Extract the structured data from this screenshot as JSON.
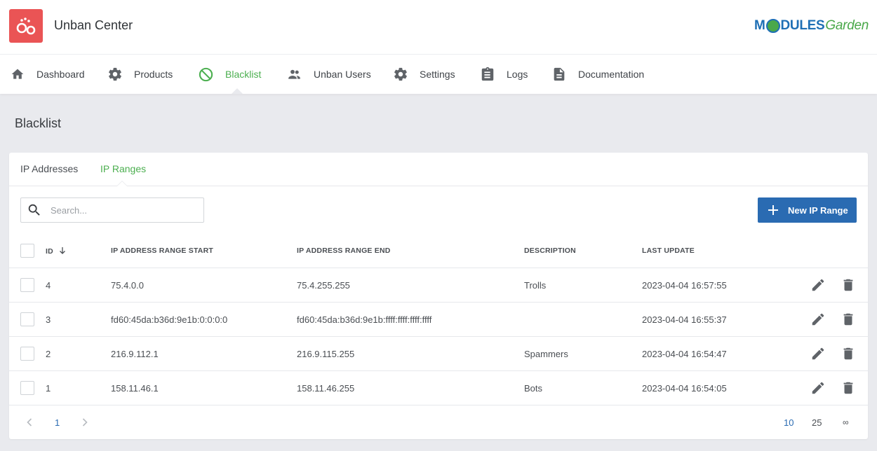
{
  "app": {
    "title": "Unban Center",
    "logo_modules": "M",
    "logo_modules_rest": "DULES",
    "logo_garden": "Garden"
  },
  "nav": {
    "items": [
      {
        "label": "Dashboard",
        "icon": "home-icon"
      },
      {
        "label": "Products",
        "icon": "gear-icon"
      },
      {
        "label": "Blacklist",
        "icon": "block-icon",
        "active": true
      },
      {
        "label": "Unban Users",
        "icon": "users-icon"
      },
      {
        "label": "Settings",
        "icon": "gear-icon"
      },
      {
        "label": "Logs",
        "icon": "clipboard-icon"
      },
      {
        "label": "Documentation",
        "icon": "document-icon"
      }
    ]
  },
  "page": {
    "title": "Blacklist"
  },
  "tabs": [
    {
      "label": "IP Addresses"
    },
    {
      "label": "IP Ranges",
      "active": true
    }
  ],
  "search": {
    "placeholder": "Search..."
  },
  "toolbar": {
    "new_label": "New IP Range"
  },
  "table": {
    "columns": [
      "ID",
      "IP ADDRESS RANGE START",
      "IP ADDRESS RANGE END",
      "DESCRIPTION",
      "LAST UPDATE"
    ],
    "sort": {
      "column": "ID",
      "direction": "desc"
    },
    "rows": [
      {
        "id": "4",
        "start": "75.4.0.0",
        "end": "75.4.255.255",
        "description": "Trolls",
        "updated": "2023-04-04 16:57:55"
      },
      {
        "id": "3",
        "start": "fd60:45da:b36d:9e1b:0:0:0:0",
        "end": "fd60:45da:b36d:9e1b:ffff:ffff:ffff:ffff",
        "description": "",
        "updated": "2023-04-04 16:55:37"
      },
      {
        "id": "2",
        "start": "216.9.112.1",
        "end": "216.9.115.255",
        "description": "Spammers",
        "updated": "2023-04-04 16:54:47"
      },
      {
        "id": "1",
        "start": "158.11.46.1",
        "end": "158.11.46.255",
        "description": "Bots",
        "updated": "2023-04-04 16:54:05"
      }
    ]
  },
  "pagination": {
    "current_page": "1",
    "page_sizes": [
      "10",
      "25",
      "∞"
    ],
    "selected_size": "10"
  },
  "colors": {
    "accent": "#4caf50",
    "primary": "#2a6bb2",
    "brand": "#ea5455"
  }
}
